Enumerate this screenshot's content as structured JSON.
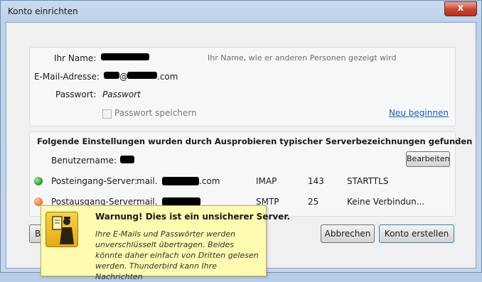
{
  "window": {
    "title": "Konto einrichten",
    "close_glyph": "x"
  },
  "account": {
    "name_label": "Ihr Name:",
    "name_hint": "Ihr Name, wie er anderen Personen gezeigt wird",
    "email_label": "E-Mail-Adresse:",
    "email_at": "@",
    "email_tld": ".com",
    "password_label": "Passwort:",
    "password_value": "Passwort",
    "remember_password_label": "Passwort speichern",
    "restart_link": "Neu beginnen"
  },
  "settings": {
    "heading": "Folgende Einstellungen wurden durch Ausprobieren typischer Serverbezeichnungen gefunden",
    "username_label": "Benutzername:",
    "edit_button": "Bearbeiten",
    "incoming": {
      "label": "Posteingang-Server:",
      "host_prefix": "mail.",
      "host_suffix": ".com",
      "protocol": "IMAP",
      "port": "143",
      "security": "STARTTLS",
      "status_color": "#2fa52f"
    },
    "outgoing": {
      "label": "Postausgang-Server:",
      "host_prefix": "mail.",
      "protocol": "SMTP",
      "port": "25",
      "security": "Keine Verbindun...",
      "status_color": "#ef7a3a"
    }
  },
  "footer": {
    "left_button_partial": "B",
    "cancel_button": "Abbrechen",
    "create_button": "Konto erstellen"
  },
  "warning": {
    "icon": "security-warning-icon",
    "title": "Warnung! Dies ist ein unsicherer Server.",
    "body": "Ihre E-Mails und Passwörter werden unverschlüsselt übertragen. Beides könnte daher einfach von Dritten gelesen werden. Thunderbird kann Ihre Nachrichten"
  }
}
